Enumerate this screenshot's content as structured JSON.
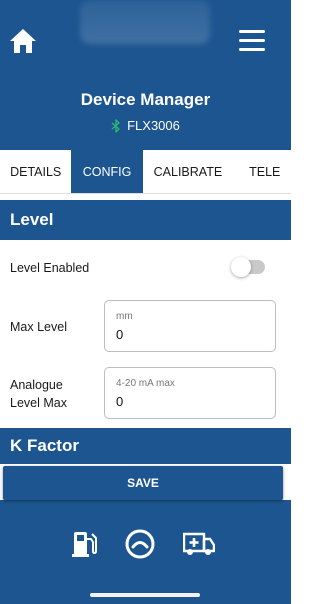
{
  "header": {
    "title": "Device Manager",
    "device_id": "FLX3006",
    "home_icon": "home-icon",
    "menu_icon": "hamburger-menu-icon",
    "bluetooth_icon": "bluetooth-icon"
  },
  "tabs": [
    {
      "label": "DETAILS",
      "active": false
    },
    {
      "label": "CONFIG",
      "active": true
    },
    {
      "label": "CALIBRATE",
      "active": false
    },
    {
      "label": "TELE",
      "active": false
    }
  ],
  "level_section": {
    "title": "Level",
    "level_enabled_label": "Level Enabled",
    "level_enabled": false,
    "max_level_label": "Max Level",
    "max_level_placeholder": "mm",
    "max_level_value": "0",
    "analogue_label_line1": "Analogue",
    "analogue_label_line2": "Level Max",
    "analogue_placeholder": "4-20 mA max",
    "analogue_value": "0"
  },
  "kfactor_section": {
    "title": "K Factor"
  },
  "actions": {
    "save_label": "SAVE"
  },
  "footer_nav": {
    "icons": [
      "fuel-pump-icon",
      "gauge-icon",
      "ambulance-icon"
    ]
  },
  "colors": {
    "primary": "#1c5590",
    "bluetooth": "#2bb673",
    "toggle_off": "#c9c9c9"
  }
}
